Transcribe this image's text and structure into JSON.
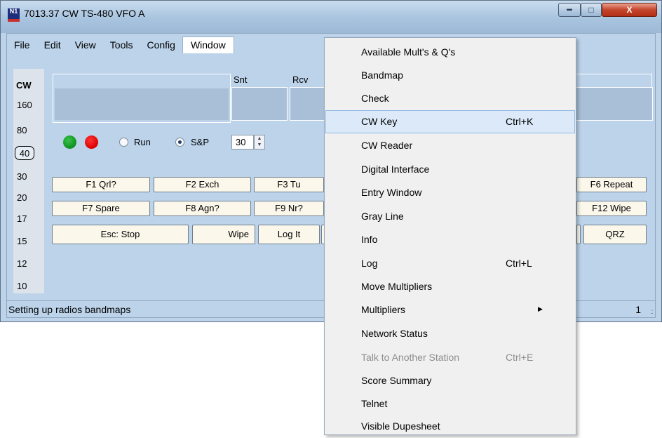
{
  "window": {
    "title": "7013.37 CW TS-480 VFO A",
    "logo_text": "N1",
    "min_glyph": "━",
    "max_glyph": "□",
    "close_glyph": "X"
  },
  "menubar": {
    "items": [
      "File",
      "Edit",
      "View",
      "Tools",
      "Config",
      "Window"
    ]
  },
  "bands": {
    "mode": "CW",
    "list": [
      "160",
      "80",
      "40",
      "30",
      "20",
      "17",
      "15",
      "12",
      "10"
    ],
    "selected": "40"
  },
  "entry": {
    "snt_label": "Snt",
    "rcv_label": "Rcv"
  },
  "controls": {
    "run_label": "Run",
    "sp_label": "S&P",
    "sp_selected": true,
    "spin_value": "30",
    "spin_up": "▲",
    "spin_down": "▼"
  },
  "fkeys": {
    "row1": [
      "F1 Qrl?",
      "F2 Exch",
      "F3 Tu",
      "F6 Repeat"
    ],
    "row2": [
      "F7 Spare",
      "F8 Agn?",
      "F9 Nr?",
      "F12 Wipe"
    ],
    "row3": [
      "Esc: Stop",
      "Wipe",
      "Log It",
      "QRZ"
    ]
  },
  "statusbar": {
    "text": "Setting up radios  bandmaps",
    "count": "1",
    "grip": ".::"
  },
  "window_menu": {
    "highlighted": "CW Key",
    "items": [
      {
        "label": "Available Mult's & Q's",
        "shortcut": ""
      },
      {
        "label": "Bandmap",
        "shortcut": ""
      },
      {
        "label": "Check",
        "shortcut": ""
      },
      {
        "label": "CW Key",
        "shortcut": "Ctrl+K"
      },
      {
        "label": "CW Reader",
        "shortcut": ""
      },
      {
        "label": "Digital Interface",
        "shortcut": ""
      },
      {
        "label": "Entry Window",
        "shortcut": ""
      },
      {
        "label": "Gray Line",
        "shortcut": ""
      },
      {
        "label": "Info",
        "shortcut": ""
      },
      {
        "label": "Log",
        "shortcut": "Ctrl+L"
      },
      {
        "label": "Move Multipliers",
        "shortcut": ""
      },
      {
        "label": "Multipliers",
        "shortcut": "",
        "submenu": true,
        "arrow": "▶"
      },
      {
        "label": "Network Status",
        "shortcut": ""
      },
      {
        "label": "Talk to Another Station",
        "shortcut": "Ctrl+E",
        "disabled": true
      },
      {
        "label": "Score Summary",
        "shortcut": ""
      },
      {
        "label": "Telnet",
        "shortcut": ""
      },
      {
        "label": "Visible Dupesheet",
        "shortcut": ""
      }
    ]
  },
  "colors": {
    "window_bg": "#bcd3ea",
    "field_bg": "#a8bfd7",
    "menu_highlight": "#dbe9f8",
    "led_green": "#109020",
    "led_red": "#dd0000"
  }
}
